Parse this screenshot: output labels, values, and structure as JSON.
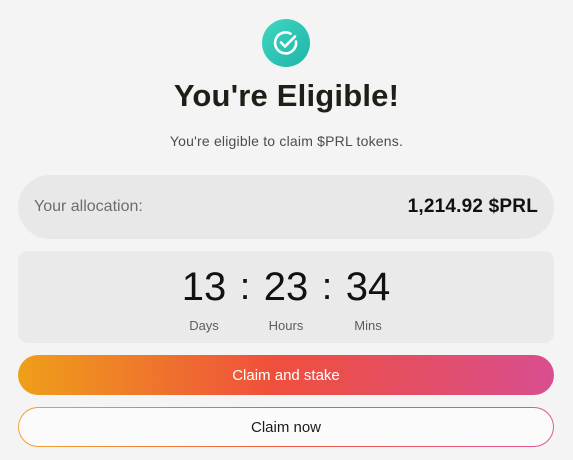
{
  "header": {
    "icon": "check-circle-icon",
    "title": "You're Eligible!",
    "subtitle": "You're eligible to claim $PRL tokens."
  },
  "allocation": {
    "label": "Your allocation:",
    "value": "1,214.92 $PRL"
  },
  "countdown": {
    "days": "13",
    "days_label": "Days",
    "hours": "23",
    "hours_label": "Hours",
    "mins": "34",
    "mins_label": "Mins",
    "separator": ":"
  },
  "actions": {
    "stake_label": "Claim and stake",
    "claim_label": "Claim now"
  },
  "colors": {
    "badge": "#2cc4b4",
    "gradient_start": "#ef9f1a",
    "gradient_mid": "#ef4f3c",
    "gradient_end": "#d84e8f"
  }
}
